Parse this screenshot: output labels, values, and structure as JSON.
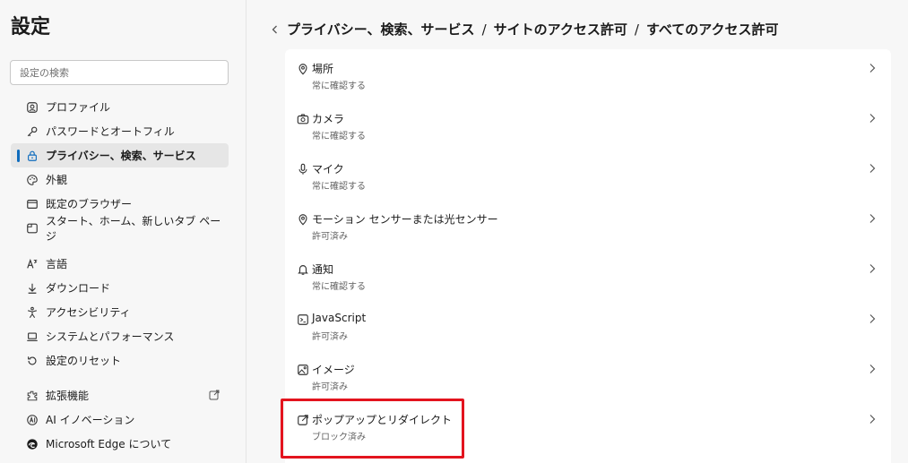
{
  "app": {
    "title": "設定"
  },
  "search": {
    "placeholder": "設定の検索"
  },
  "sidebar": {
    "group1": [
      {
        "label": "プロファイル",
        "icon": "profile-icon"
      },
      {
        "label": "パスワードとオートフィル",
        "icon": "key-icon"
      },
      {
        "label": "プライバシー、検索、サービス",
        "icon": "lock-icon",
        "active": true
      },
      {
        "label": "外観",
        "icon": "palette-icon"
      },
      {
        "label": "既定のブラウザー",
        "icon": "browser-icon"
      },
      {
        "label": "スタート、ホーム、新しいタブ ページ",
        "icon": "home-tab-icon"
      }
    ],
    "group2": [
      {
        "label": "言語",
        "icon": "language-icon"
      },
      {
        "label": "ダウンロード",
        "icon": "download-icon"
      },
      {
        "label": "アクセシビリティ",
        "icon": "accessibility-icon"
      },
      {
        "label": "システムとパフォーマンス",
        "icon": "laptop-icon"
      },
      {
        "label": "設定のリセット",
        "icon": "reset-icon"
      }
    ],
    "group3": [
      {
        "label": "拡張機能",
        "icon": "extensions-icon"
      },
      {
        "label": "AI イノベーション",
        "icon": "ai-icon"
      },
      {
        "label": "Microsoft Edge について",
        "icon": "edge-logo-icon"
      }
    ]
  },
  "breadcrumb": {
    "items": [
      "プライバシー、検索、サービス",
      "サイトのアクセス許可",
      "すべてのアクセス許可"
    ],
    "separator": "/"
  },
  "permissions": [
    {
      "title": "場所",
      "status": "常に確認する",
      "icon": "location-icon"
    },
    {
      "title": "カメラ",
      "status": "常に確認する",
      "icon": "camera-icon"
    },
    {
      "title": "マイク",
      "status": "常に確認する",
      "icon": "microphone-icon"
    },
    {
      "title": "モーション センサーまたは光センサー",
      "status": "許可済み",
      "icon": "sensor-icon"
    },
    {
      "title": "通知",
      "status": "常に確認する",
      "icon": "bell-icon"
    },
    {
      "title": "JavaScript",
      "status": "許可済み",
      "icon": "script-icon"
    },
    {
      "title": "イメージ",
      "status": "許可済み",
      "icon": "image-icon"
    },
    {
      "title": "ポップアップとリダイレクト",
      "status": "ブロック済み",
      "icon": "popup-icon"
    }
  ],
  "colors": {
    "accent": "#0f6cbd",
    "highlight": "#e3141e"
  }
}
